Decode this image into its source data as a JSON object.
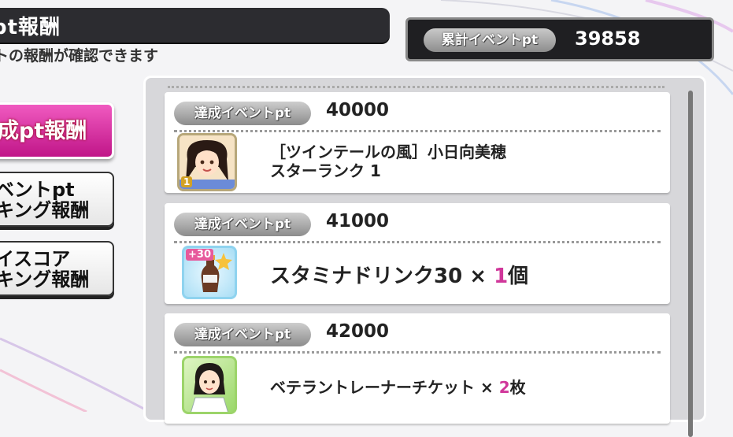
{
  "header": {
    "title": "pt報酬",
    "subtitle": "トの報酬が確認できます"
  },
  "total": {
    "label": "累計イベントpt",
    "value": "39858"
  },
  "tabs": [
    {
      "lines": [
        "成pt報酬"
      ]
    },
    {
      "lines": [
        "ベントpt",
        "キング報酬"
      ]
    },
    {
      "lines": [
        "イスコア",
        "キング報酬"
      ]
    }
  ],
  "rewards": [
    {
      "badge": "達成イベントpt",
      "pt": "40000",
      "line1": "［ツインテールの風］小日向美穂",
      "line2": "スターランク 1",
      "thumb_label": "1"
    },
    {
      "badge": "達成イベントpt",
      "pt": "41000",
      "item": "スタミナドリンク30 × ",
      "qty": "1",
      "unit": "個",
      "thumb_label": "+30"
    },
    {
      "badge": "達成イベントpt",
      "pt": "42000",
      "item": "ベテラントレーナーチケット × ",
      "qty": "2",
      "unit": "枚"
    }
  ],
  "colors": {
    "accent_pink": "#d0369a",
    "tab_active": "#e23caf",
    "dark_bar": "#2c2c30"
  }
}
